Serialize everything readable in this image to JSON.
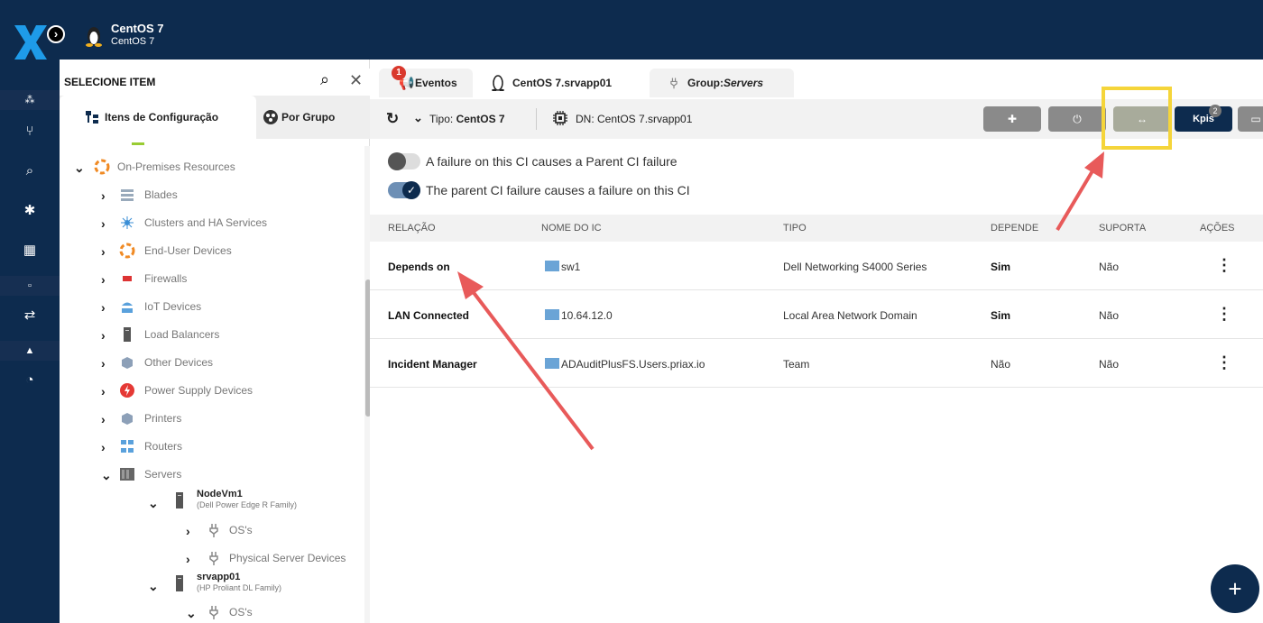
{
  "header": {
    "ci_title": "CentOS 7",
    "ci_subtitle": "CentOS 7",
    "logo": "x-logo",
    "expand_icon": "chevron-right-icon"
  },
  "leftbar": {
    "icons": [
      "dots-icon",
      "topology-icon",
      "zoom-search-icon",
      "gear-icon",
      "grid-icon",
      "doc-icon",
      "split-icon",
      "user-icon",
      "gauge-icon"
    ]
  },
  "panel": {
    "title": "SELECIONE ITEM",
    "tab_ci": "Itens de Configuração",
    "tab_group": "Por Grupo",
    "tree": [
      {
        "label": "On-Premises Resources"
      },
      {
        "label": "Blades"
      },
      {
        "label": "Clusters and HA Services"
      },
      {
        "label": "End-User Devices"
      },
      {
        "label": "Firewalls"
      },
      {
        "label": "IoT Devices"
      },
      {
        "label": "Load Balancers"
      },
      {
        "label": "Other Devices"
      },
      {
        "label": "Power Supply Devices"
      },
      {
        "label": "Printers"
      },
      {
        "label": "Routers"
      },
      {
        "label": "Servers"
      },
      {
        "label": "NodeVm1",
        "sub": "(Dell Power Edge R Family)"
      },
      {
        "label": "OS's"
      },
      {
        "label": "Physical Server Devices"
      },
      {
        "label": "srvapp01",
        "sub": "(HP Proliant DL Family)"
      },
      {
        "label": "OS's"
      }
    ]
  },
  "tabs": {
    "events": "Eventos",
    "events_badge": "1",
    "ci": "CentOS 7.srvapp01",
    "group_prefix": "Group:",
    "group_name": "Servers"
  },
  "toolbar": {
    "tipo_label": "Tipo: ",
    "tipo_value": "CentOS 7",
    "dn": "DN: CentOS 7.srvapp01",
    "kpis": "Kpis",
    "kpis_badge": "2",
    "btn3_glyph": "↔"
  },
  "toggles": {
    "parent_failure": {
      "label": "A failure on this CI causes a Parent CI failure",
      "on": false
    },
    "child_failure": {
      "label": "The parent CI failure causes a failure on this CI",
      "on": true
    }
  },
  "table": {
    "headers": [
      "RELAÇÃO",
      "NOME DO IC",
      "TIPO",
      "DEPENDE",
      "SUPORTA",
      "AÇÕES"
    ],
    "rows": [
      {
        "relacao": "Depends on",
        "nome": "sw1",
        "tipo": "Dell Networking S4000 Series",
        "depende": "Sim",
        "suporta": "Não"
      },
      {
        "relacao": "LAN Connected",
        "nome": "10.64.12.0",
        "tipo": "Local Area Network Domain",
        "depende": "Sim",
        "suporta": "Não"
      },
      {
        "relacao": "Incident Manager",
        "nome": "ADAuditPlusFS.Users.priax.io",
        "tipo": "Team",
        "depende": "Não",
        "suporta": "Não"
      }
    ]
  },
  "fab": "+",
  "colors": {
    "navy": "#0d2b4e",
    "highlight": "#f5d53a",
    "arrow": "#e85a5a"
  }
}
